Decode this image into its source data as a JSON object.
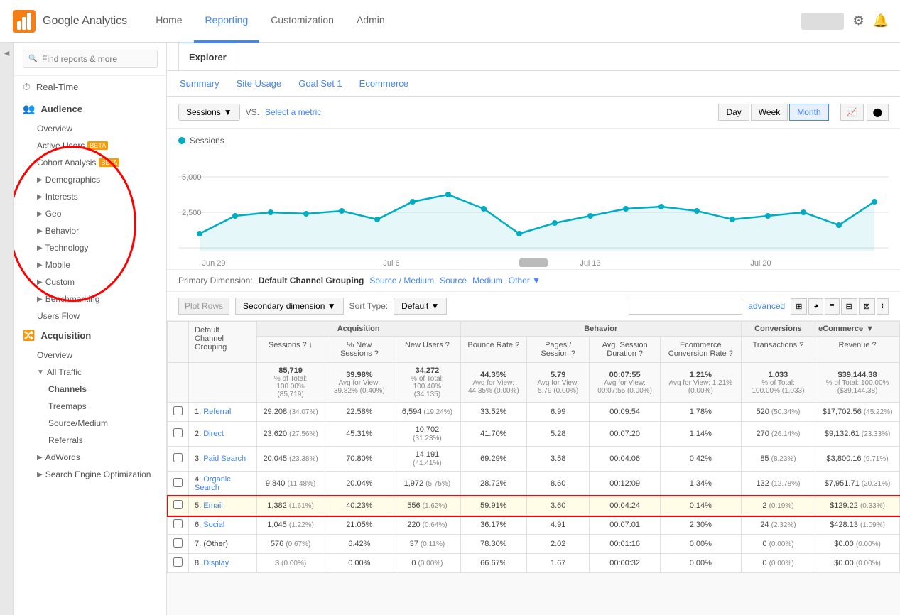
{
  "app": {
    "logo_text": "Google Analytics",
    "nav_links": [
      "Home",
      "Reporting",
      "Customization",
      "Admin"
    ],
    "active_nav": "Reporting"
  },
  "sidebar": {
    "search_placeholder": "Find reports & more",
    "sections": [
      {
        "id": "realtime",
        "label": "Real-Time",
        "icon": "⏱",
        "level": 0
      },
      {
        "id": "audience",
        "label": "Audience",
        "icon": "👥",
        "level": 0
      },
      {
        "id": "overview",
        "label": "Overview",
        "level": 1
      },
      {
        "id": "active_users",
        "label": "Active Users",
        "badge": "BETA",
        "level": 1
      },
      {
        "id": "cohort",
        "label": "Cohort Analysis",
        "badge": "BETA",
        "level": 1
      },
      {
        "id": "demographics",
        "label": "Demographics",
        "arrow": "▶",
        "level": 1
      },
      {
        "id": "interests",
        "label": "Interests",
        "arrow": "▶",
        "level": 1
      },
      {
        "id": "geo",
        "label": "Geo",
        "arrow": "▶",
        "level": 1
      },
      {
        "id": "behavior",
        "label": "Behavior",
        "arrow": "▶",
        "level": 1
      },
      {
        "id": "technology",
        "label": "Technology",
        "arrow": "▶",
        "level": 1
      },
      {
        "id": "mobile",
        "label": "Mobile",
        "arrow": "▶",
        "level": 1
      },
      {
        "id": "custom",
        "label": "Custom",
        "arrow": "▶",
        "level": 1
      },
      {
        "id": "benchmarking",
        "label": "Benchmarking",
        "arrow": "▶",
        "level": 1
      },
      {
        "id": "users_flow",
        "label": "Users Flow",
        "level": 1
      },
      {
        "id": "acquisition",
        "label": "Acquisition",
        "icon": "🔀",
        "level": 0
      },
      {
        "id": "acq_overview",
        "label": "Overview",
        "level": 1
      },
      {
        "id": "all_traffic",
        "label": "▼ All Traffic",
        "level": 1
      },
      {
        "id": "channels",
        "label": "Channels",
        "level": 2,
        "active": true
      },
      {
        "id": "treemaps",
        "label": "Treemaps",
        "level": 2
      },
      {
        "id": "source_medium",
        "label": "Source/Medium",
        "level": 2
      },
      {
        "id": "referrals",
        "label": "Referrals",
        "level": 2
      },
      {
        "id": "adwords",
        "label": "▶ AdWords",
        "level": 1
      },
      {
        "id": "seo",
        "label": "▶ Search Engine Optimization",
        "level": 1
      }
    ]
  },
  "explorer": {
    "tab": "Explorer",
    "sub_tabs": [
      "Summary",
      "Site Usage",
      "Goal Set 1",
      "Ecommerce"
    ],
    "active_sub_tab": "Summary"
  },
  "chart": {
    "metric_btn": "Sessions",
    "vs_text": "VS.",
    "select_metric": "Select a metric",
    "legend_label": "Sessions",
    "y_labels": [
      "5,000",
      "2,500"
    ],
    "x_labels": [
      "Jun 29",
      "Jul 6",
      "Jul 13",
      "Jul 20"
    ],
    "date_btns": [
      "Day",
      "Week",
      "Month"
    ],
    "active_date_btn": "Month"
  },
  "dimension_bar": {
    "label": "Primary Dimension:",
    "options": [
      "Default Channel Grouping",
      "Source / Medium",
      "Source",
      "Medium",
      "Other ▼"
    ],
    "active": "Default Channel Grouping"
  },
  "table_controls": {
    "plot_rows_btn": "Plot Rows",
    "sec_dim_btn": "Secondary dimension ▼",
    "sort_label": "Sort Type:",
    "sort_btn": "Default ▼",
    "adv_link": "advanced"
  },
  "table": {
    "col_groups": [
      {
        "label": "Acquisition",
        "span": 3
      },
      {
        "label": "Behavior",
        "span": 4
      },
      {
        "label": "Conversions",
        "span": 1
      },
      {
        "label": "eCommerce ▼",
        "span": 2
      }
    ],
    "headers": [
      "Default Channel Grouping",
      "Sessions",
      "% New Sessions",
      "New Users",
      "Bounce Rate",
      "Pages / Session",
      "Avg. Session Duration",
      "Ecommerce Conversion Rate",
      "Transactions",
      "Revenue"
    ],
    "totals": {
      "sessions": "85,719",
      "sessions_sub": "% of Total: 100.00% (85,719)",
      "pct_new": "39.98%",
      "pct_new_sub": "Avg for View: 39.82% (0.40%)",
      "new_users": "34,272",
      "new_users_sub": "% of Total: 100.40% (34,135)",
      "bounce_rate": "44.35%",
      "bounce_sub": "Avg for View: 44.35% (0.00%)",
      "pages_session": "5.79",
      "pages_sub": "Avg for View: 5.79 (0.00%)",
      "avg_duration": "00:07:55",
      "avg_dur_sub": "Avg for View: 00:07:55 (0.00%)",
      "ecomm_rate": "1.21%",
      "ecomm_sub": "Avg for View: 1.21% (0.00%)",
      "transactions": "1,033",
      "trans_sub": "% of Total: 100.00% (1,033)",
      "revenue": "$39,144.38",
      "rev_sub": "% of Total: 100.00% ($39,144.38)"
    },
    "rows": [
      {
        "num": "1",
        "name": "Referral",
        "link": true,
        "sessions": "29,208",
        "sessions_pct": "(34.07%)",
        "pct_new": "22.58%",
        "new_users": "6,594",
        "new_pct": "(19.24%)",
        "bounce": "33.52%",
        "pages": "6.99",
        "duration": "00:09:54",
        "ecomm": "1.78%",
        "trans": "520",
        "trans_pct": "(50.34%)",
        "revenue": "$17,702.56",
        "rev_pct": "(45.22%)"
      },
      {
        "num": "2",
        "name": "Direct",
        "link": true,
        "sessions": "23,620",
        "sessions_pct": "(27.56%)",
        "pct_new": "45.31%",
        "new_users": "10,702",
        "new_pct": "(31.23%)",
        "bounce": "41.70%",
        "pages": "5.28",
        "duration": "00:07:20",
        "ecomm": "1.14%",
        "trans": "270",
        "trans_pct": "(26.14%)",
        "revenue": "$9,132.61",
        "rev_pct": "(23.33%)"
      },
      {
        "num": "3",
        "name": "Paid Search",
        "link": true,
        "sessions": "20,045",
        "sessions_pct": "(23.38%)",
        "pct_new": "70.80%",
        "new_users": "14,191",
        "new_pct": "(41.41%)",
        "bounce": "69.29%",
        "pages": "3.58",
        "duration": "00:04:06",
        "ecomm": "0.42%",
        "trans": "85",
        "trans_pct": "(8.23%)",
        "revenue": "$3,800.16",
        "rev_pct": "(9.71%)"
      },
      {
        "num": "4",
        "name": "Organic Search",
        "link": true,
        "sessions": "9,840",
        "sessions_pct": "(11.48%)",
        "pct_new": "20.04%",
        "new_users": "1,972",
        "new_pct": "(5.75%)",
        "bounce": "28.72%",
        "pages": "8.60",
        "duration": "00:12:09",
        "ecomm": "1.34%",
        "trans": "132",
        "trans_pct": "(12.78%)",
        "revenue": "$7,951.71",
        "rev_pct": "(20.31%)"
      },
      {
        "num": "5",
        "name": "Email",
        "link": true,
        "highlighted": true,
        "sessions": "1,382",
        "sessions_pct": "(1.61%)",
        "pct_new": "40.23%",
        "new_users": "556",
        "new_pct": "(1.62%)",
        "bounce": "59.91%",
        "pages": "3.60",
        "duration": "00:04:24",
        "ecomm": "0.14%",
        "trans": "2",
        "trans_pct": "(0.19%)",
        "revenue": "$129.22",
        "rev_pct": "(0.33%)"
      },
      {
        "num": "6",
        "name": "Social",
        "link": true,
        "sessions": "1,045",
        "sessions_pct": "(1.22%)",
        "pct_new": "21.05%",
        "new_users": "220",
        "new_pct": "(0.64%)",
        "bounce": "36.17%",
        "pages": "4.91",
        "duration": "00:07:01",
        "ecomm": "2.30%",
        "trans": "24",
        "trans_pct": "(2.32%)",
        "revenue": "$428.13",
        "rev_pct": "(1.09%)"
      },
      {
        "num": "7",
        "name": "(Other)",
        "link": false,
        "sessions": "576",
        "sessions_pct": "(0.67%)",
        "pct_new": "6.42%",
        "new_users": "37",
        "new_pct": "(0.11%)",
        "bounce": "78.30%",
        "pages": "2.02",
        "duration": "00:01:16",
        "ecomm": "0.00%",
        "trans": "0",
        "trans_pct": "(0.00%)",
        "revenue": "$0.00",
        "rev_pct": "(0.00%)"
      },
      {
        "num": "8",
        "name": "Display",
        "link": true,
        "sessions": "3",
        "sessions_pct": "(0.00%)",
        "pct_new": "0.00%",
        "new_users": "0",
        "new_pct": "(0.00%)",
        "bounce": "66.67%",
        "pages": "1.67",
        "duration": "00:00:32",
        "ecomm": "0.00%",
        "trans": "0",
        "trans_pct": "(0.00%)",
        "revenue": "$0.00",
        "rev_pct": "(0.00%)"
      }
    ]
  }
}
